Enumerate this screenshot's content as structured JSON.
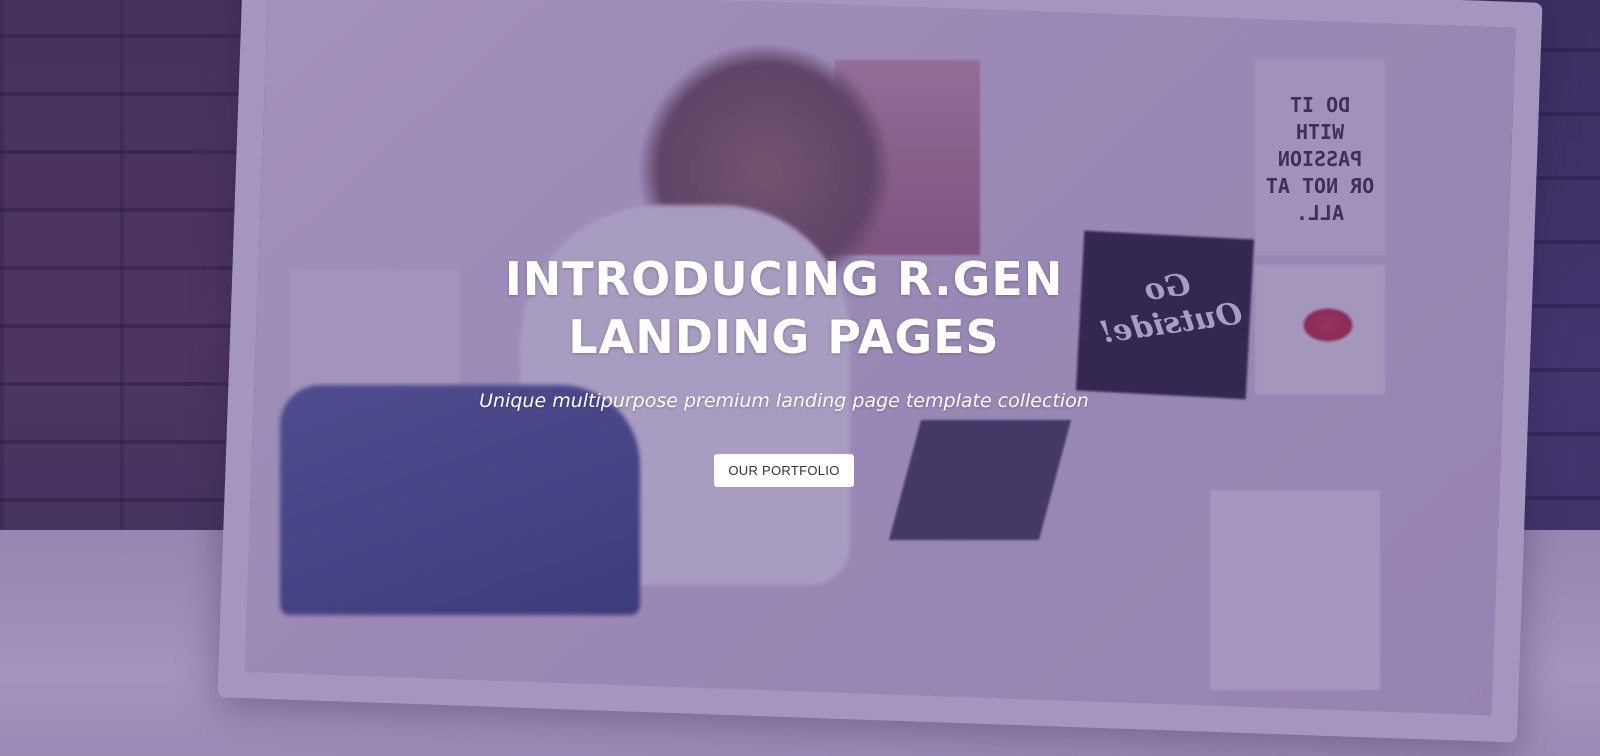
{
  "hero": {
    "title": "INTRODUCING R.GEN LANDING PAGES",
    "subtitle": "Unique multipurpose premium landing page template collection",
    "button_label": "OUR PORTFOLIO"
  },
  "background_image": {
    "poster_text": "DO IT WITH PASSION OR NOT AT ALL.",
    "dark_poster_text": "Go Outside!"
  },
  "colors": {
    "overlay": "#50378266",
    "button_bg": "#ffffff",
    "button_text": "#333333",
    "title_text": "#ffffff"
  }
}
